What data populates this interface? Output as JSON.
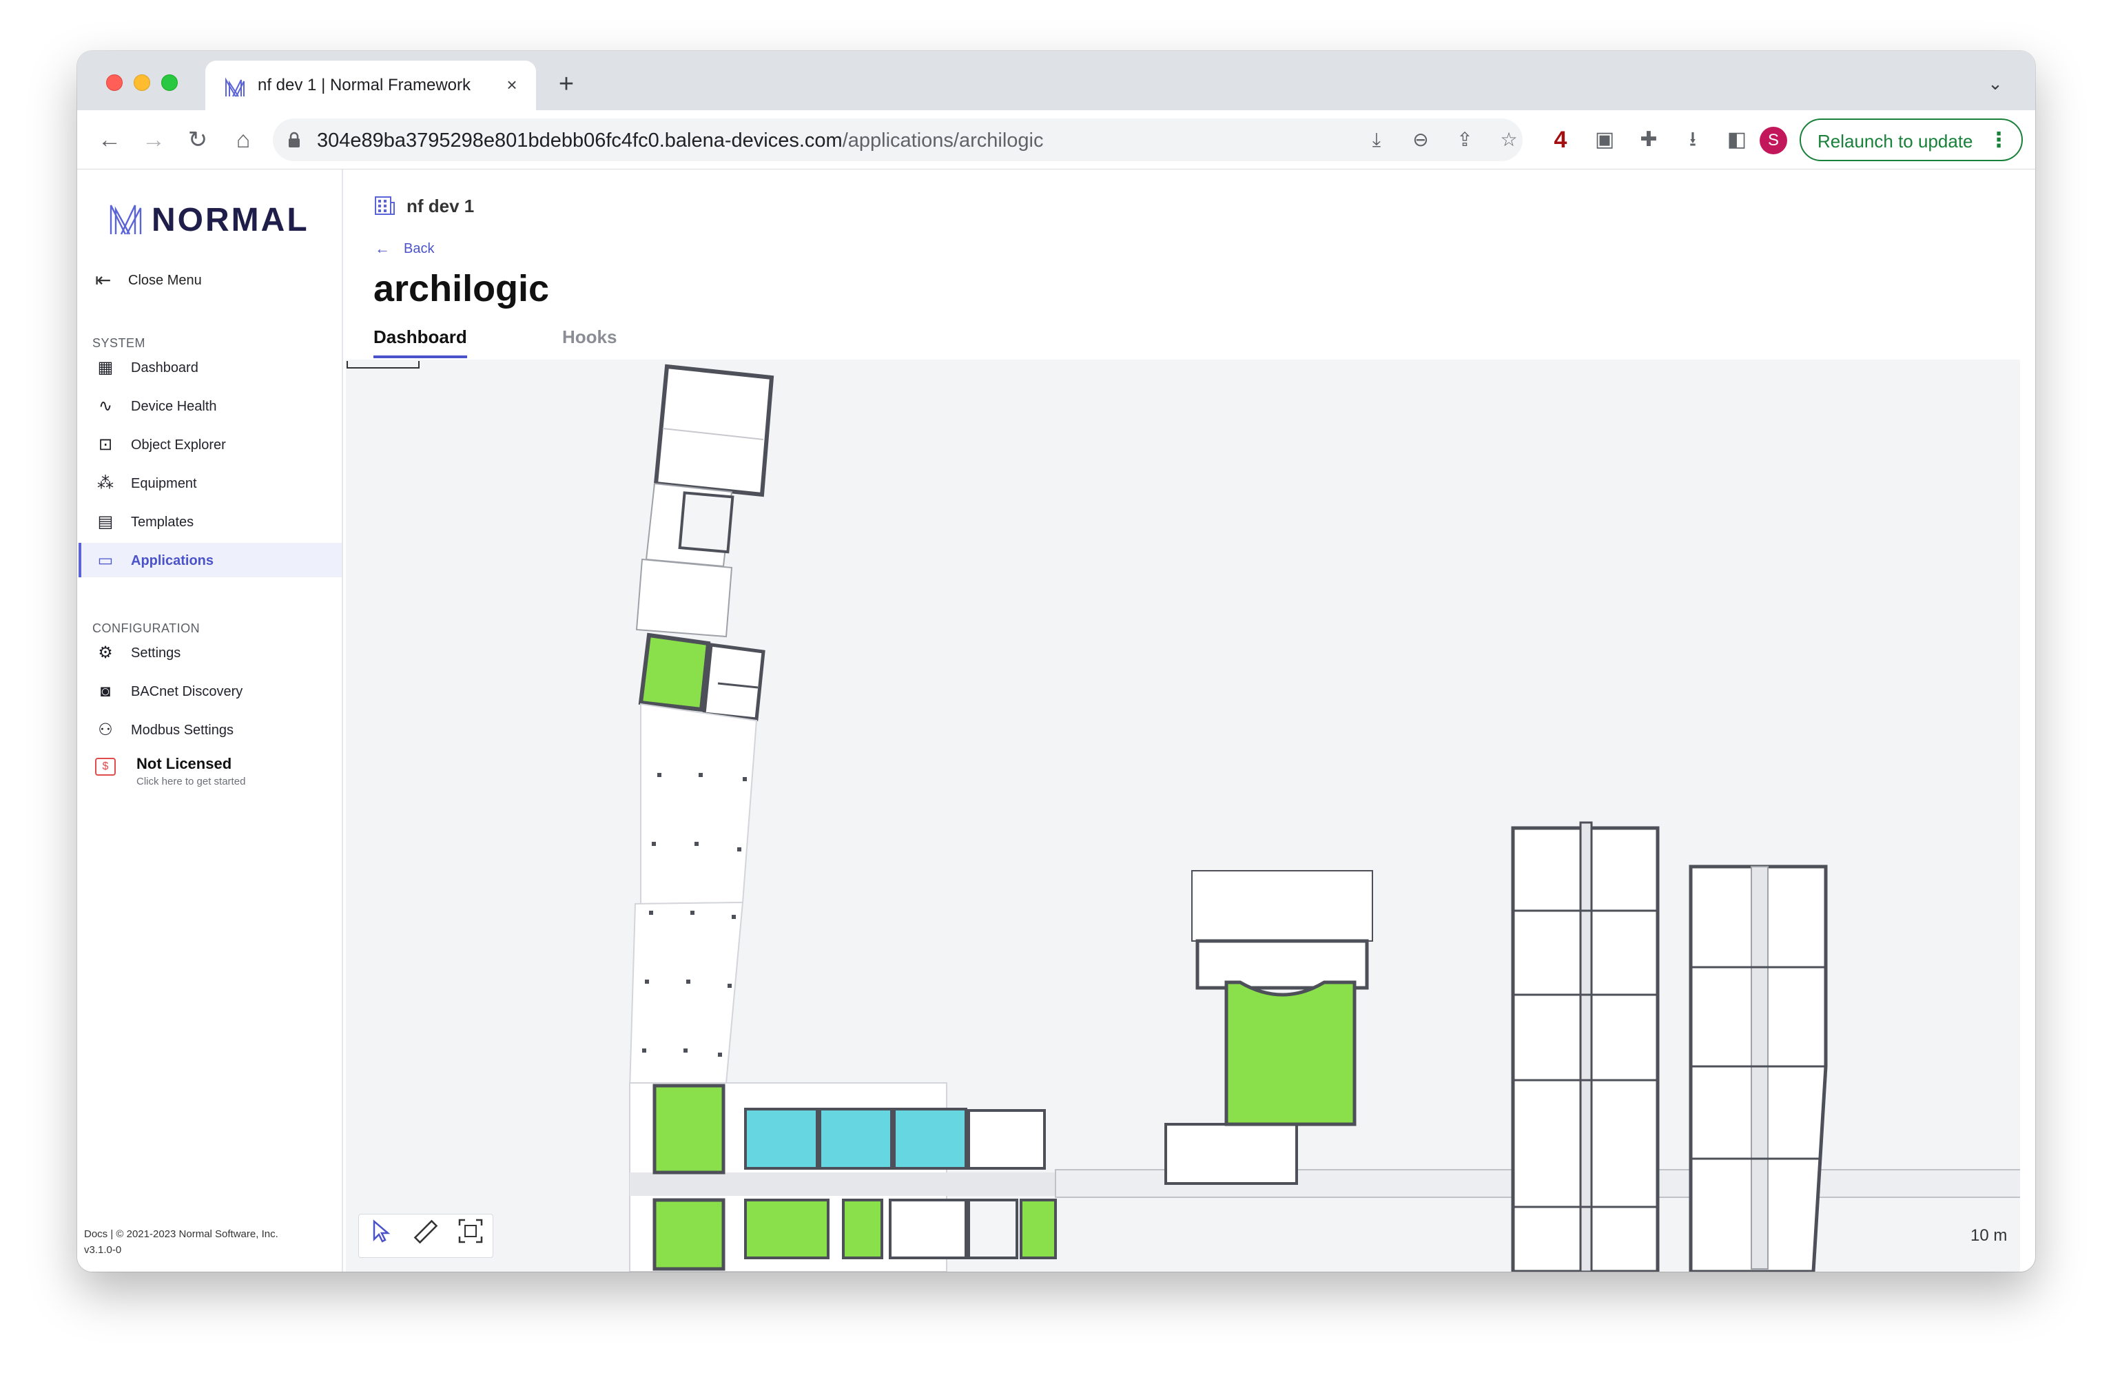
{
  "browser": {
    "tab_title": "nf dev 1 | Normal Framework",
    "tab_close": "×",
    "new_tab": "+",
    "tab_list": "⌄",
    "url_host": "304e89ba3795298e801bdebb06fc4fc0.balena-devices.com",
    "url_path": "/applications/archilogic",
    "extension_badge": "4",
    "profile_initial": "S",
    "relaunch_label": "Relaunch to update",
    "relaunch_menu": "⋮"
  },
  "sidebar": {
    "logo_text": "NORMAL",
    "close_menu": "Close Menu",
    "system_title": "SYSTEM",
    "system_items": [
      {
        "label": "Dashboard",
        "icon": "dashboard-icon"
      },
      {
        "label": "Device Health",
        "icon": "pulse-icon"
      },
      {
        "label": "Object Explorer",
        "icon": "object-explorer-icon"
      },
      {
        "label": "Equipment",
        "icon": "equipment-icon"
      },
      {
        "label": "Templates",
        "icon": "document-icon"
      },
      {
        "label": "Applications",
        "icon": "window-icon",
        "active": true
      }
    ],
    "config_title": "CONFIGURATION",
    "config_items": [
      {
        "label": "Settings",
        "icon": "gear-icon"
      },
      {
        "label": "BACnet Discovery",
        "icon": "bacnet-discovery-icon"
      },
      {
        "label": "Modbus Settings",
        "icon": "network-tree-icon"
      }
    ],
    "license_title": "Not Licensed",
    "license_subtitle": "Click here to get started",
    "footer_line1": "Docs | © 2021-2023 Normal Software, Inc.",
    "footer_line2": "v3.1.0-0"
  },
  "main": {
    "breadcrumb": "nf dev 1",
    "back_label": "Back",
    "title": "archilogic",
    "tabs": [
      {
        "label": "Dashboard",
        "active": true
      },
      {
        "label": "Hooks",
        "active": false
      }
    ],
    "scale_label": "10 m"
  },
  "colors": {
    "accent": "#4a53c9",
    "room_green": "#8ae04a",
    "room_cyan": "#66d7e0",
    "wall": "#4d5058",
    "relaunch_green": "#188038"
  }
}
